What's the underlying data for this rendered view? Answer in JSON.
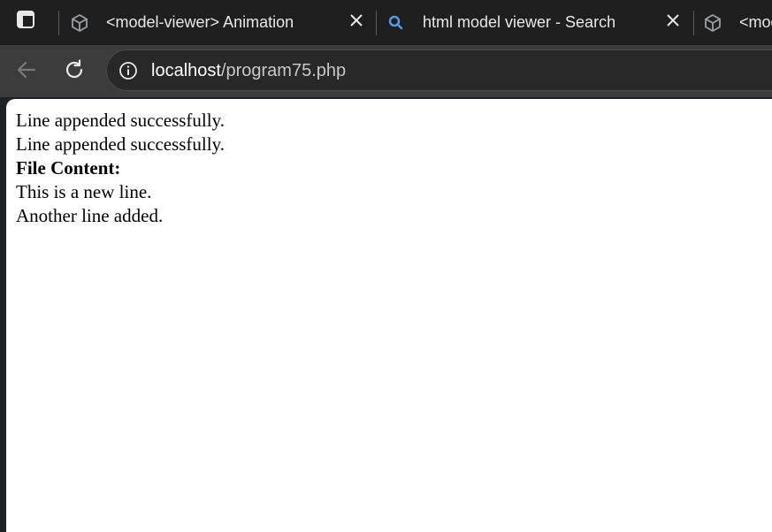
{
  "browser": {
    "tabs": [
      {
        "title": "<model-viewer> Animation",
        "icon": "cube-icon",
        "closable": true
      },
      {
        "title": "html model viewer - Search",
        "icon": "search-icon",
        "closable": true
      },
      {
        "title": "<mod",
        "icon": "cube-icon",
        "closable": false
      }
    ],
    "address_bar": {
      "host": "localhost",
      "path": "/program75.php"
    },
    "colors": {
      "tabstrip": "#1f1f1f",
      "toolbar": "#3c3c3c",
      "search_accent": "#4a9fe8"
    }
  },
  "page": {
    "lines": [
      "Line appended successfully.",
      "Line appended successfully."
    ],
    "heading": "File Content:",
    "file_lines": [
      "This is a new line.",
      "Another line added."
    ]
  }
}
